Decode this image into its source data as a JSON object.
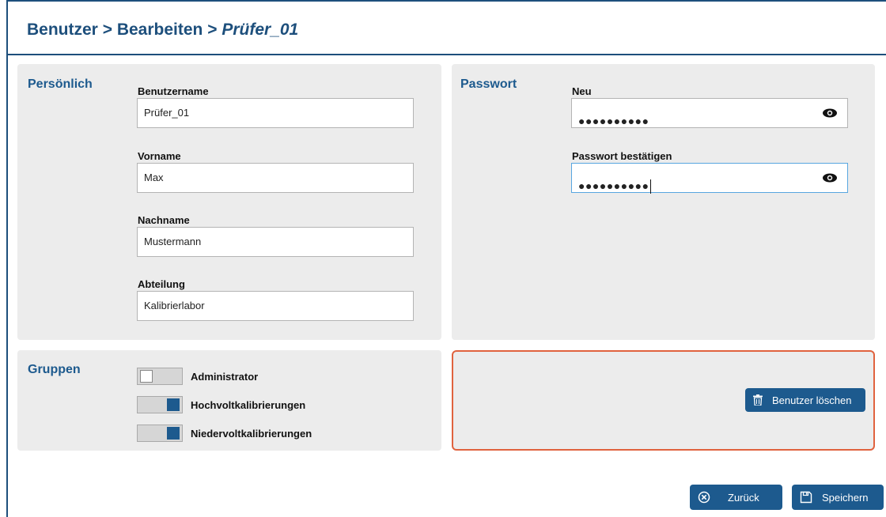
{
  "breadcrumb": {
    "part1": "Benutzer",
    "sep1": ">",
    "part2": "Bearbeiten",
    "sep2": ">",
    "current": "Prüfer_01"
  },
  "personal": {
    "title": "Persönlich",
    "username_label": "Benutzername",
    "username_value": "Prüfer_01",
    "firstname_label": "Vorname",
    "firstname_value": "Max",
    "lastname_label": "Nachname",
    "lastname_value": "Mustermann",
    "department_label": "Abteilung",
    "department_value": "Kalibrierlabor"
  },
  "password": {
    "title": "Passwort",
    "new_label": "Neu",
    "new_value": "●●●●●●●●●●",
    "confirm_label": "Passwort bestätigen",
    "confirm_value": "●●●●●●●●●●"
  },
  "groups": {
    "title": "Gruppen",
    "items": [
      {
        "label": "Administrator",
        "enabled": false
      },
      {
        "label": "Hochvoltkalibrierungen",
        "enabled": true
      },
      {
        "label": "Niedervoltkalibrierungen",
        "enabled": true
      }
    ]
  },
  "actions": {
    "delete_label": "Benutzer löschen",
    "back_label": "Zurück",
    "save_label": "Speichern"
  },
  "colors": {
    "primary": "#1d5a8e",
    "header": "#1d4f7c",
    "danger_border": "#e0623e",
    "panel_bg": "#ececec"
  },
  "icons": {
    "password_toggle": "eye-icon",
    "delete": "trash-icon",
    "back": "cancel-circle-icon",
    "save": "floppy-disk-icon"
  }
}
